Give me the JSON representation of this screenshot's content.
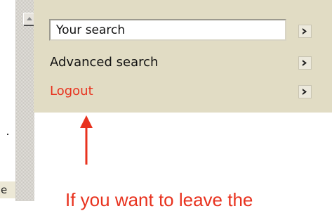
{
  "left_fragment": "e",
  "search": {
    "value": "Your search"
  },
  "menu": {
    "advanced_search_label": "Advanced search",
    "logout_label": "Logout"
  },
  "annotation": {
    "text": "If you want to leave the"
  },
  "icons": {
    "scroll_up": "scroll-up-arrow-icon",
    "go": "chevron-right-icon",
    "pointer": "up-arrow-icon"
  },
  "colors": {
    "panel_background": "#e1dcc4",
    "logout_text": "#e8321e",
    "annotation": "#e8321e",
    "go_arrow": "#1a1a1a"
  }
}
